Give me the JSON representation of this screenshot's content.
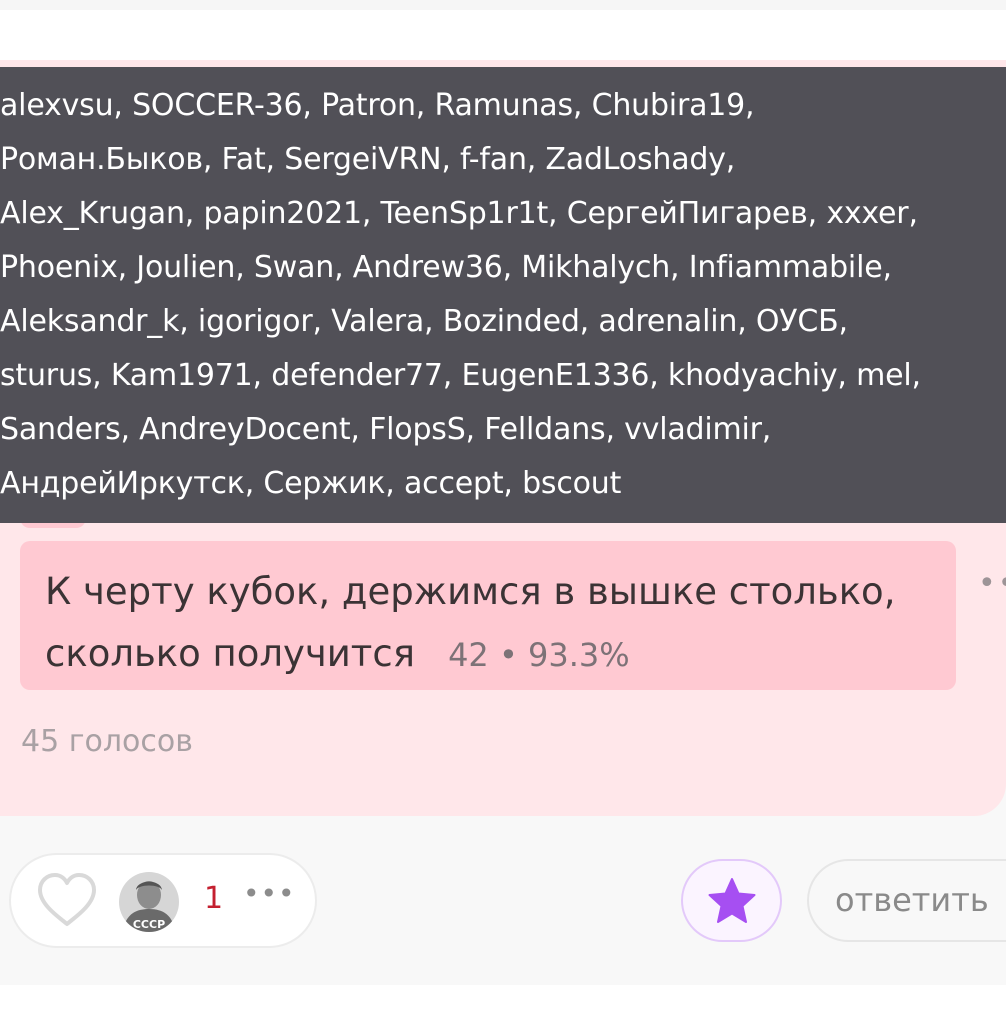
{
  "tooltip": {
    "voters": "alexvsu, SOCCER-36, Patron, Ramunas, Chubira19,\nРоман.Быков, Fat, SergeiVRN, f-fan, ZadLoshady,\nAlex_Krugan, papin2021, TeenSp1r1t, СергейПигарев, xxxer,\nPhoenix, Joulien, Swan, Andrew36, Mikhalych, Infiammabile,\nAleksandr_k, igorigor, Valera, Bozinded, adrenalin, ОУСБ,\nsturus, Kam1971, defender77, EugenE1336, khodyachiy, mel,\nSanders, AndreyDocent, FlopsS, Felldans, vvladimir,\nАндрейИркутск, Сержик, accept, bscout"
  },
  "poll": {
    "option": {
      "text": "К черту кубок, держимся в вышке столько, сколько получится",
      "stats": "42 • 93.3%",
      "votes": 42,
      "percent": 93.3,
      "more_icon": "ellipsis-icon"
    },
    "total_votes": "45 голосов"
  },
  "actions": {
    "like_icon": "heart-outline-icon",
    "avatar_caption": "СССР",
    "like_count": "1",
    "likes_more": "•••",
    "favorite_icon": "star-icon",
    "reply_label": "ответить"
  },
  "colors": {
    "tooltip_bg": "#515057",
    "card_bg": "#ffe7ea",
    "option_fill": "#ffc9d2",
    "like_count": "#c42030",
    "favorite_star": "#a64ff2"
  }
}
